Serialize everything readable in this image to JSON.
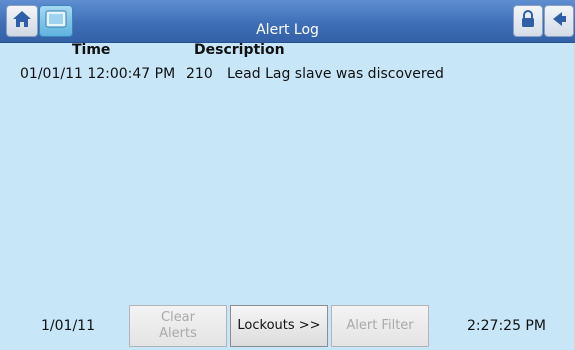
{
  "header": {
    "title": "Alert Log",
    "icons": {
      "home": "home-icon",
      "screen": "screen-icon",
      "lock": "lock-icon",
      "back": "back-arrow-icon"
    }
  },
  "table": {
    "columns": [
      "Time",
      "Description"
    ],
    "rows": [
      {
        "time": "01/01/11 12:00:47 PM",
        "code": "210",
        "description": "Lead Lag slave was discovered"
      }
    ]
  },
  "footer": {
    "date": "1/01/11",
    "time": "2:27:25 PM",
    "clear_alerts": {
      "line1": "Clear",
      "line2": "Alerts"
    },
    "lockouts": "Lockouts >>",
    "alert_filter": "Alert Filter"
  },
  "colors": {
    "header_blue": "#3f6fb7",
    "screen_bg": "#c7e7f8"
  }
}
